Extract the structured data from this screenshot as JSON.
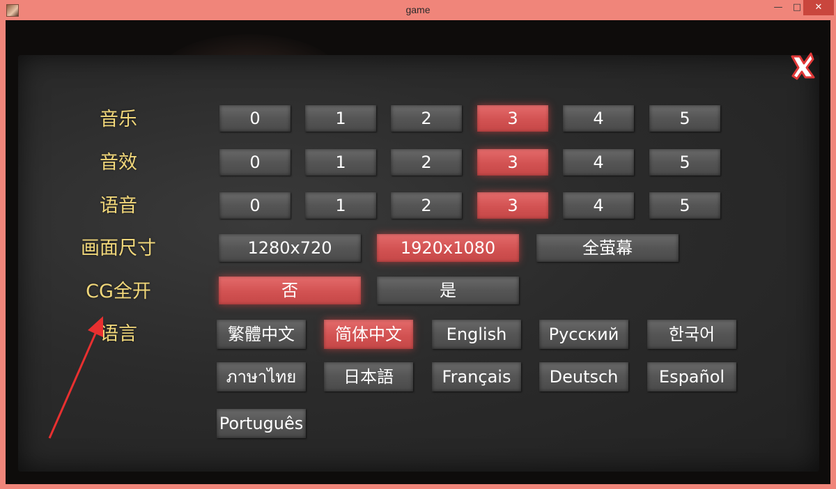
{
  "window": {
    "title": "game"
  },
  "labels": {
    "music": "音乐",
    "sfx": "音效",
    "voice": "语音",
    "screen_size": "画面尺寸",
    "cg_unlock": "CG全开",
    "language": "语言"
  },
  "music_options": [
    "0",
    "1",
    "2",
    "3",
    "4",
    "5"
  ],
  "music_selected": "3",
  "sfx_options": [
    "0",
    "1",
    "2",
    "3",
    "4",
    "5"
  ],
  "sfx_selected": "3",
  "voice_options": [
    "0",
    "1",
    "2",
    "3",
    "4",
    "5"
  ],
  "voice_selected": "3",
  "screen_options": [
    "1280x720",
    "1920x1080",
    "全萤幕"
  ],
  "screen_selected": "1920x1080",
  "cg_options": [
    "否",
    "是"
  ],
  "cg_selected": "否",
  "language_options": [
    "繁體中文",
    "简体中文",
    "English",
    "Русский",
    "한국어",
    "ภาษาไทย",
    "日本語",
    "Français",
    "Deutsch",
    "Español",
    "Português"
  ],
  "language_selected": "简体中文",
  "colors": {
    "titlebar": "#f0857a",
    "label_text": "#f1d77a",
    "selected": "#d25252",
    "option": "#555555",
    "close_button": "#c9463d"
  },
  "icons": {
    "close": "close-x-icon",
    "annotation": "red-arrow"
  }
}
